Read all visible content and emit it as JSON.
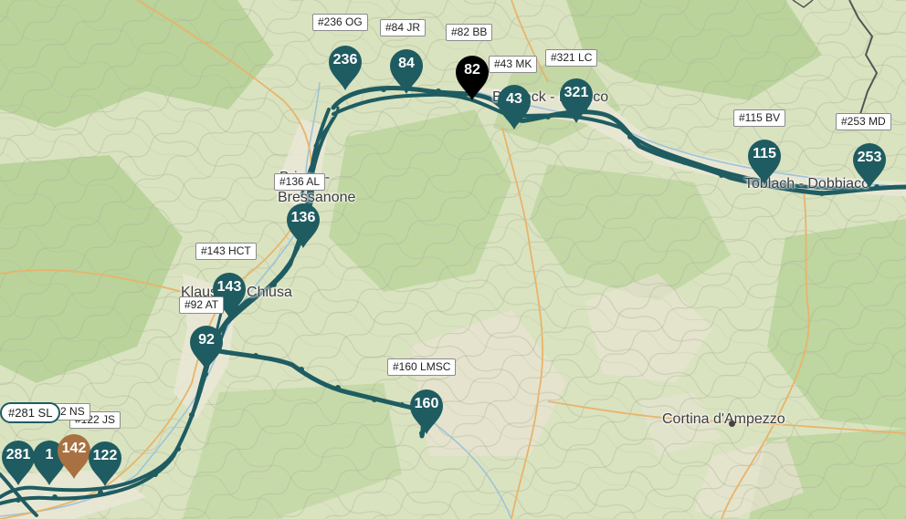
{
  "places": [
    {
      "id": "brixen-1",
      "text": "Brixen -"
    },
    {
      "id": "brixen-2",
      "text": "Bressanone"
    },
    {
      "id": "klausen",
      "text": "Klausen - Chiusa"
    },
    {
      "id": "bruneck",
      "text": "Bruneck - Brunico"
    },
    {
      "id": "toblach",
      "text": "Toblach - Dobbiaco"
    },
    {
      "id": "cortina",
      "text": "Cortina d'Ampezzo"
    }
  ],
  "tags": [
    {
      "id": "236",
      "text": "#236 OG"
    },
    {
      "id": "84",
      "text": "#84 JR"
    },
    {
      "id": "82",
      "text": "#82 BB"
    },
    {
      "id": "43",
      "text": "#43 MK"
    },
    {
      "id": "321",
      "text": "#321 LC"
    },
    {
      "id": "115",
      "text": "#115 BV"
    },
    {
      "id": "253",
      "text": "#253 MD"
    },
    {
      "id": "136",
      "text": "#136 AL"
    },
    {
      "id": "143",
      "text": "#143 HCT"
    },
    {
      "id": "92",
      "text": "#92 AT"
    },
    {
      "id": "160",
      "text": "#160 LMSC"
    },
    {
      "id": "281",
      "text": "#281 SL"
    },
    {
      "id": "142",
      "text": "#142 NS"
    },
    {
      "id": "122",
      "text": "#122 JS"
    }
  ],
  "markers": [
    {
      "id": "236",
      "num": "236",
      "color": "#1f5c61"
    },
    {
      "id": "84",
      "num": "84",
      "color": "#1f5c61"
    },
    {
      "id": "82",
      "num": "82",
      "color": "#000000"
    },
    {
      "id": "43",
      "num": "43",
      "color": "#1f5c61"
    },
    {
      "id": "321",
      "num": "321",
      "color": "#1f5c61"
    },
    {
      "id": "115",
      "num": "115",
      "color": "#1f5c61"
    },
    {
      "id": "253",
      "num": "253",
      "color": "#1f5c61"
    },
    {
      "id": "136",
      "num": "136",
      "color": "#1f5c61"
    },
    {
      "id": "143",
      "num": "143",
      "color": "#1f5c61"
    },
    {
      "id": "92",
      "num": "92",
      "color": "#1f5c61"
    },
    {
      "id": "160",
      "num": "160",
      "color": "#1f5c61"
    },
    {
      "id": "281",
      "num": "281",
      "color": "#1f5c61"
    },
    {
      "id": "1xx",
      "num": "1",
      "color": "#1f5c61"
    },
    {
      "id": "142",
      "num": "142",
      "color": "#a97142"
    },
    {
      "id": "122",
      "num": "122",
      "color": "#1f5c61"
    }
  ],
  "colors": {
    "track": "#1f5c61",
    "highlight": "#a97142",
    "selected": "#000000",
    "road": "#e8b46b",
    "border": "#555555"
  }
}
